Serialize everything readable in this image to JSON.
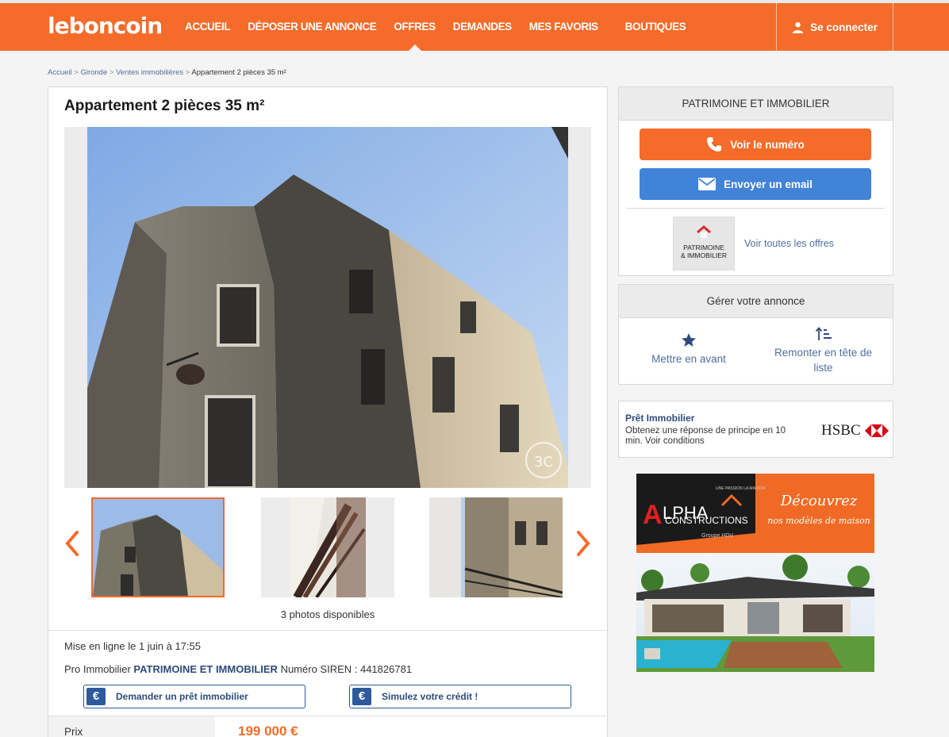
{
  "header": {
    "logo": "leboncoin",
    "nav": [
      {
        "label": "ACCUEIL",
        "active": false
      },
      {
        "label": "DÉPOSER UNE ANNONCE",
        "active": false
      },
      {
        "label": "OFFRES",
        "active": true
      },
      {
        "label": "DEMANDES",
        "active": false
      },
      {
        "label": "MES FAVORIS",
        "active": false
      },
      {
        "label": "BOUTIQUES",
        "active": false
      }
    ],
    "login_label": "Se connecter"
  },
  "breadcrumb": {
    "items": [
      "Accueil",
      "Gironde",
      "Ventes immobilières"
    ],
    "separator": " > ",
    "current": "Appartement 2 pièces 35 m²"
  },
  "ad": {
    "title": "Appartement 2 pièces 35 m²",
    "watermark": "3C",
    "photo_count": "3 photos disponibles",
    "posted": "Mise en ligne le 1 juin à 17:55",
    "pro_prefix": "Pro Immobilier",
    "pro_name": "PATRIMOINE ET IMMOBILIER",
    "siren": "Numéro SIREN : 441826781",
    "loan_button": "Demander un prêt immobilier",
    "credit_button": "Simulez votre crédit !",
    "euro_symbol": "€",
    "price_label": "Prix",
    "price_value": "199 000 €"
  },
  "sidebar": {
    "seller_name": "PATRIMOINE ET IMMOBILIER",
    "call_button": "Voir le numéro",
    "email_button": "Envoyer un email",
    "seller_logo_line1": "PATRIMOINE",
    "seller_logo_line2": "& IMMOBILIER",
    "see_all_offers": "Voir toutes les offres",
    "manage_title": "Gérer votre annonce",
    "highlight_label": "Mettre en avant",
    "bump_label_line1": "Remonter en tête de",
    "bump_label_line2": "liste"
  },
  "promo": {
    "title": "Prêt Immobilier",
    "text_line1": "Obtenez une réponse de principe en 10",
    "text_line2": "min. Voir conditions",
    "bank": "HSBC"
  },
  "banner": {
    "brand_initial": "A",
    "brand_rest": "LPHA",
    "brand_line2": "CONSTRUCTIONS",
    "brand_group": "Groupe HDV",
    "brand_arc": "UNE PASSION LA MAISON",
    "headline_line1": "Découvrez",
    "headline_line2": "nos modèles de maison"
  },
  "colors": {
    "brand_orange": "#f56b2a",
    "email_blue": "#4183d7",
    "link_blue": "#4f6f9f",
    "pro_blue": "#2d4b7a"
  },
  "icons": [
    "user-icon",
    "phone-icon",
    "envelope-icon",
    "star-icon",
    "sort-up-icon",
    "chevron-left-icon",
    "chevron-right-icon",
    "euro-icon",
    "hsbc-hexagon-icon"
  ]
}
